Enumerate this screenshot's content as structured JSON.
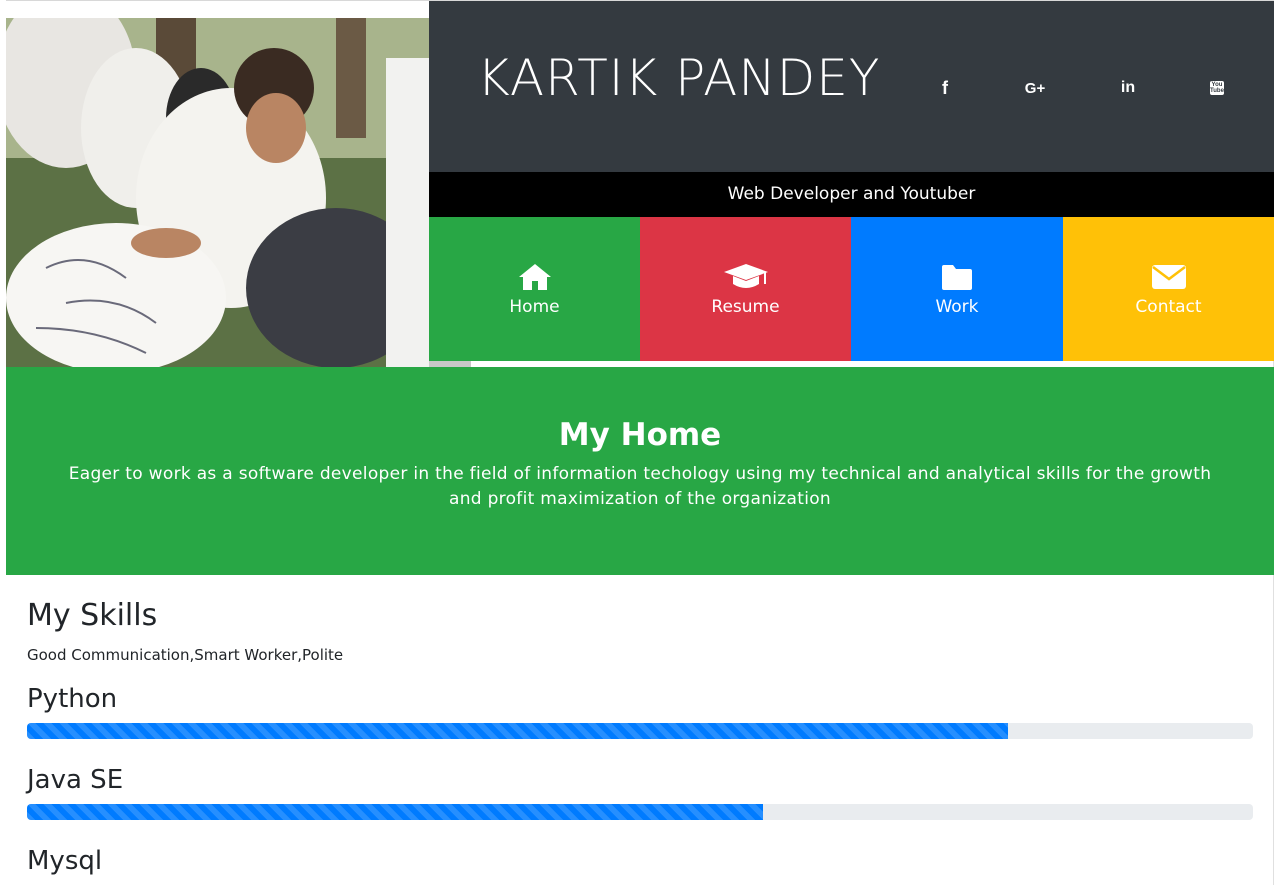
{
  "profile": {
    "name": "KARTIK PANDEY",
    "tagline": "Web Developer and Youtuber"
  },
  "social": [
    {
      "icon": "facebook-icon",
      "glyph": "f"
    },
    {
      "icon": "google-plus-icon",
      "glyph": "G+"
    },
    {
      "icon": "linkedin-icon",
      "glyph": "in"
    },
    {
      "icon": "youtube-icon",
      "glyph": "You Tube"
    }
  ],
  "nav": {
    "home": "Home",
    "resume": "Resume",
    "work": "Work",
    "contact": "Contact"
  },
  "hero": {
    "title": "My Home",
    "text": "Eager to work as a software developer in the field of information techology using my technical and analytical skills for the growth and profit maximization of the organization"
  },
  "skills": {
    "title": "My Skills",
    "description": "Good Communication,Smart Worker,Polite",
    "items": [
      {
        "name": "Python",
        "progress_percent": 80
      },
      {
        "name": "Java SE",
        "progress_percent": 60
      },
      {
        "name": "Mysql",
        "progress_percent": null
      }
    ]
  },
  "colors": {
    "header": "#343a40",
    "home": "#28a745",
    "resume": "#dc3545",
    "work": "#007bff",
    "contact": "#ffc107",
    "progress": "#007bff"
  }
}
